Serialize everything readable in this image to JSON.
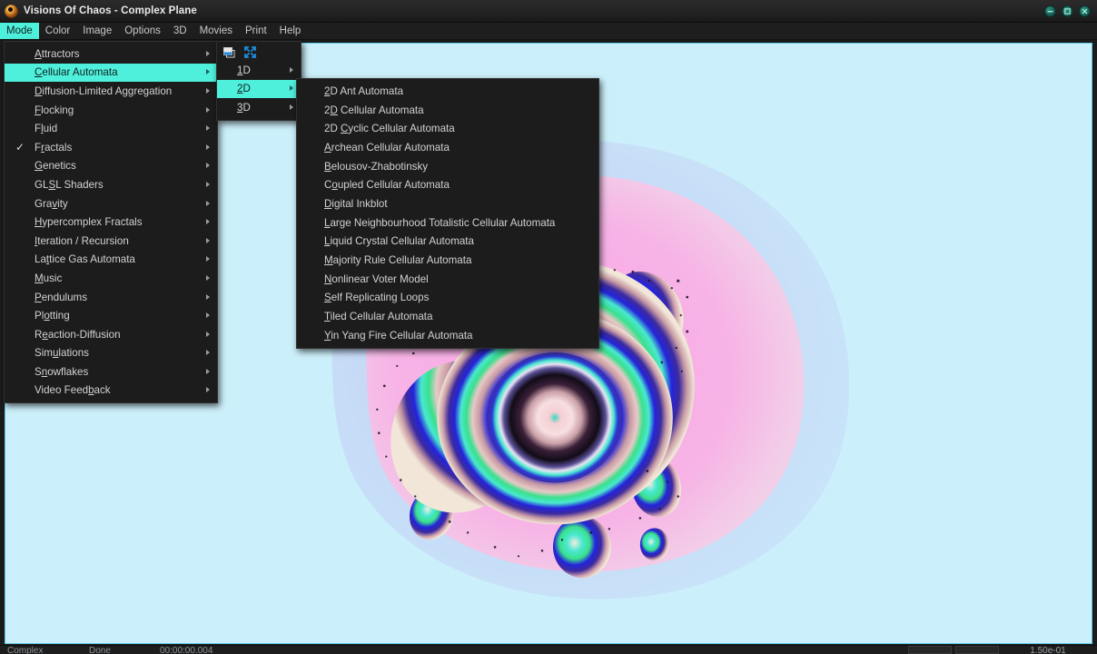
{
  "window": {
    "title": "Visions Of Chaos - Complex Plane",
    "icon": "app-swirl-icon",
    "controls": [
      {
        "name": "minimize-button",
        "glyph": "minimize-icon"
      },
      {
        "name": "maximize-button",
        "glyph": "maximize-icon"
      },
      {
        "name": "close-button",
        "glyph": "close-icon"
      }
    ]
  },
  "menubar": {
    "items": [
      {
        "label": "Mode",
        "active": true
      },
      {
        "label": "Color",
        "active": false
      },
      {
        "label": "Image",
        "active": false
      },
      {
        "label": "Options",
        "active": false
      },
      {
        "label": "3D",
        "active": false
      },
      {
        "label": "Movies",
        "active": false
      },
      {
        "label": "Print",
        "active": false
      },
      {
        "label": "Help",
        "active": false
      }
    ]
  },
  "mode_menu": {
    "items": [
      {
        "label": "Attractors",
        "accel": "A",
        "submenu": true,
        "checked": false,
        "selected": false
      },
      {
        "label": "Cellular Automata",
        "accel": "C",
        "submenu": true,
        "checked": false,
        "selected": true
      },
      {
        "label": "Diffusion-Limited Aggregation",
        "accel": "D",
        "submenu": true,
        "checked": false,
        "selected": false
      },
      {
        "label": "Flocking",
        "accel": "F",
        "submenu": true,
        "checked": false,
        "selected": false
      },
      {
        "label": "Fluid",
        "accel": "l",
        "submenu": true,
        "checked": false,
        "selected": false
      },
      {
        "label": "Fractals",
        "accel": "r",
        "submenu": true,
        "checked": true,
        "selected": false
      },
      {
        "label": "Genetics",
        "accel": "G",
        "submenu": true,
        "checked": false,
        "selected": false
      },
      {
        "label": "GLSL Shaders",
        "accel": "S",
        "submenu": true,
        "checked": false,
        "selected": false
      },
      {
        "label": "Gravity",
        "accel": "v",
        "submenu": true,
        "checked": false,
        "selected": false
      },
      {
        "label": "Hypercomplex Fractals",
        "accel": "H",
        "submenu": true,
        "checked": false,
        "selected": false
      },
      {
        "label": "Iteration / Recursion",
        "accel": "I",
        "submenu": true,
        "checked": false,
        "selected": false
      },
      {
        "label": "Lattice Gas Automata",
        "accel": "t",
        "submenu": true,
        "checked": false,
        "selected": false
      },
      {
        "label": "Music",
        "accel": "M",
        "submenu": true,
        "checked": false,
        "selected": false
      },
      {
        "label": "Pendulums",
        "accel": "P",
        "submenu": true,
        "checked": false,
        "selected": false
      },
      {
        "label": "Plotting",
        "accel": "o",
        "submenu": true,
        "checked": false,
        "selected": false
      },
      {
        "label": "Reaction-Diffusion",
        "accel": "e",
        "submenu": true,
        "checked": false,
        "selected": false
      },
      {
        "label": "Simulations",
        "accel": "u",
        "submenu": true,
        "checked": false,
        "selected": false
      },
      {
        "label": "Snowflakes",
        "accel": "n",
        "submenu": true,
        "checked": false,
        "selected": false
      },
      {
        "label": "Video Feedback",
        "accel": "b",
        "submenu": true,
        "checked": false,
        "selected": false
      }
    ]
  },
  "ca_menu": {
    "icons": [
      {
        "name": "restore-window-icon",
        "color": "#1e8bdc"
      },
      {
        "name": "resize-arrows-icon",
        "color": "#1e8bdc"
      }
    ],
    "items": [
      {
        "label": "1D",
        "accel": "1",
        "submenu": true,
        "selected": false
      },
      {
        "label": "2D",
        "accel": "2",
        "submenu": true,
        "selected": true
      },
      {
        "label": "3D",
        "accel": "3",
        "submenu": true,
        "selected": false
      }
    ]
  },
  "ca_2d_menu": {
    "items": [
      {
        "label": "2D Ant Automata",
        "accel": "2"
      },
      {
        "label": "2D Cellular Automata",
        "accel": "D"
      },
      {
        "label": "2D Cyclic Cellular Automata",
        "accel": "C"
      },
      {
        "label": "Archean Cellular Automata",
        "accel": "A"
      },
      {
        "label": "Belousov-Zhabotinsky",
        "accel": "B"
      },
      {
        "label": "Coupled Cellular Automata",
        "accel": "o"
      },
      {
        "label": "Digital Inkblot",
        "accel": "D"
      },
      {
        "label": "Large Neighbourhood Totalistic Cellular Automata",
        "accel": "L"
      },
      {
        "label": "Liquid Crystal Cellular Automata",
        "accel": "L"
      },
      {
        "label": "Majority Rule Cellular Automata",
        "accel": "M"
      },
      {
        "label": "Nonlinear Voter Model",
        "accel": "N"
      },
      {
        "label": "Self Replicating Loops",
        "accel": "S"
      },
      {
        "label": "Tiled Cellular Automata",
        "accel": "T"
      },
      {
        "label": "Yin Yang Fire Cellular Automata",
        "accel": "Y"
      }
    ]
  },
  "statusbar": {
    "mode": "Complex",
    "state": "Done",
    "time": "00:00:00.004",
    "zoom": "1.50e-01"
  },
  "canvas": {
    "name": "fractal-render",
    "background": "#ccf0fb",
    "border": "#59c9e8"
  },
  "fractal_colors": {
    "background": "#ccf0fb",
    "halo": "#c2dcf7",
    "lavender": "#cdc6ef",
    "pink": "#f9a8e8",
    "cream": "#f2e6d8",
    "green": "#3ae08c",
    "cyan": "#49e8d0",
    "blue": "#2424dc",
    "indigo": "#3c2a9e",
    "dark": "#120c18",
    "core": "#f2c5c9",
    "center": "#3ad8c0"
  }
}
